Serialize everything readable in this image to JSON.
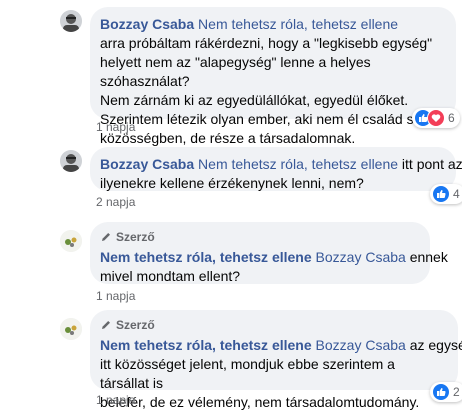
{
  "comments": [
    {
      "author": "Bozzay Csaba",
      "mention": "Nem tehetsz róla, tehetsz ellene",
      "text_after_mention": "",
      "lines": [
        "arra próbáltam rákérdezni, hogy a \"legkisebb egység\"",
        "helyett nem az \"alapegység\" lenne a helyes szóhasználat?",
        "Nem zárnám ki az egyedülállókat, egyedül élőket.",
        "Szerintem létezik olyan ember, aki nem él család szerű",
        "közösségben, de része a társadalomnak."
      ],
      "time": "1 napja",
      "reactions": {
        "count": "6",
        "icons": [
          "like-icon",
          "love-icon"
        ]
      }
    },
    {
      "author": "Bozzay Csaba",
      "mention": "Nem tehetsz róla, tehetsz ellene",
      "text_after_mention": " itt pont az",
      "lines": [
        "ilyenekre kellene érzékenynek lenni, nem?"
      ],
      "time": "2 napja",
      "reactions": {
        "count": "4",
        "icons": [
          "like-icon"
        ]
      }
    },
    {
      "badge": "Szerző",
      "author": "Nem tehetsz róla, tehetsz ellene",
      "mention": "Bozzay Csaba",
      "text_after_mention": " ennek",
      "lines": [
        "mivel mondtam ellent?"
      ],
      "time": "1 napja"
    },
    {
      "badge": "Szerző",
      "author": "Nem tehetsz róla, tehetsz ellene",
      "mention": "Bozzay Csaba",
      "text_after_mention": " az egység",
      "lines": [
        "itt közösséget jelent, mondjuk ebbe szerintem a társállat is",
        "belefér, de ez vélemény, nem társadalomtudomány."
      ],
      "time": "1 napja",
      "reactions": {
        "count": "2",
        "icons": [
          "like-icon"
        ]
      }
    }
  ],
  "colors": {
    "link": "#385898",
    "bubble": "#f0f2f5",
    "meta": "#65676b",
    "like": "#1877f2",
    "love": "#f33e58"
  }
}
